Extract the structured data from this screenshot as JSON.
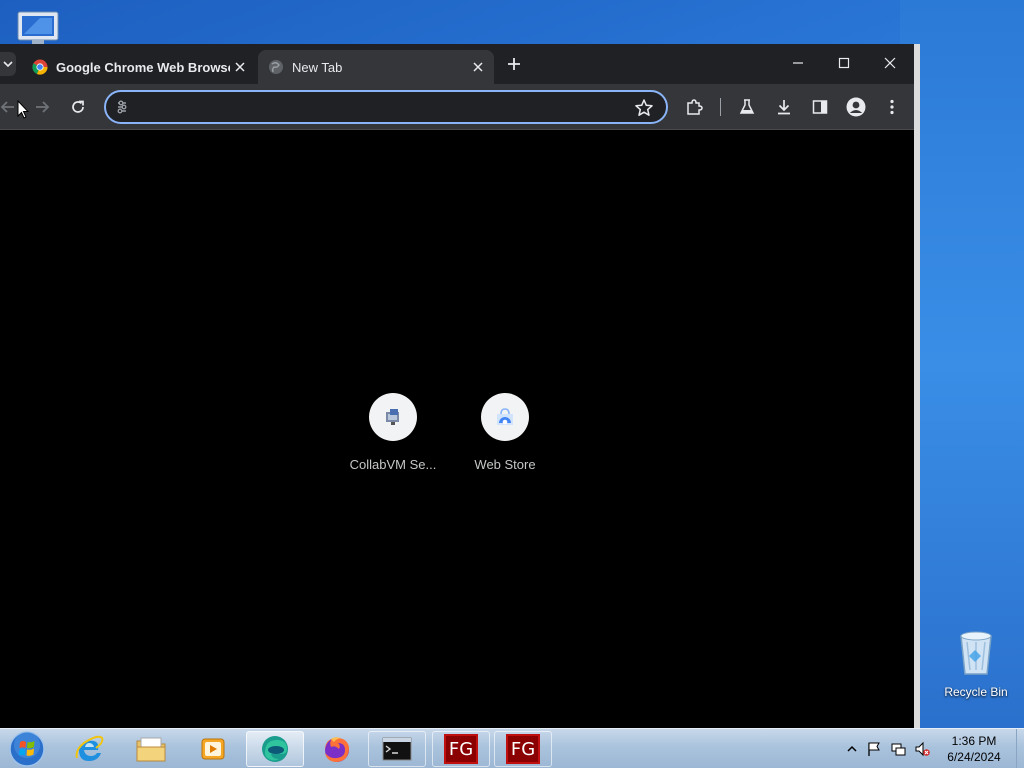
{
  "desktop": {
    "recycle_bin_label": "Recycle Bin"
  },
  "browser": {
    "tabs": [
      {
        "title": "Google Chrome Web Browser",
        "active": false
      },
      {
        "title": "New Tab",
        "active": true
      }
    ],
    "omnibox": {
      "value": "",
      "placeholder": ""
    },
    "shortcuts": [
      {
        "label": "CollabVM Se...",
        "icon": "collabvm-icon"
      },
      {
        "label": "Web Store",
        "icon": "web-store-icon"
      }
    ],
    "colors": {
      "accent": "#8ab4f8",
      "tabstrip": "#202124",
      "toolbar": "#35363a"
    }
  },
  "taskbar": {
    "items": [
      "internet-explorer-icon",
      "file-explorer-icon",
      "media-player-icon",
      "edge-icon",
      "firefox-icon",
      "command-prompt-icon",
      "fg-app-icon",
      "fg-app-icon"
    ],
    "fg_label": "FG",
    "clock": {
      "time": "1:36 PM",
      "date": "6/24/2024"
    }
  }
}
